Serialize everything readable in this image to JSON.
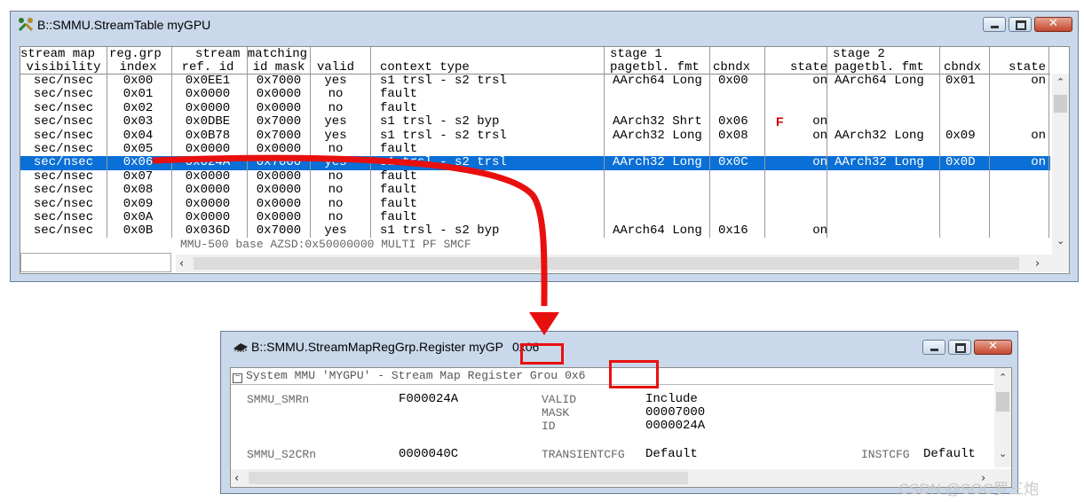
{
  "window1": {
    "title": "B::SMMU.StreamTable myGPU",
    "header_line1": [
      "stream map",
      "reg.grp",
      "stream matching",
      "stage 1",
      "stage 2"
    ],
    "header_line2": [
      "visibility",
      "index",
      "ref. id",
      "id mask",
      "valid",
      "context type",
      "pagetbl. fmt",
      "cbndx",
      "state",
      "pagetbl. fmt",
      "cbndx",
      "state"
    ],
    "rows": [
      [
        "sec/nsec",
        "0x00",
        "0x0EE1",
        "0x7000",
        "yes",
        "s1 trsl - s2 trsl",
        "AArch64 Long",
        "0x00",
        "",
        "on",
        "AArch64 Long",
        "0x01",
        "on"
      ],
      [
        "sec/nsec",
        "0x01",
        "0x0000",
        "0x0000",
        "no",
        "fault",
        "",
        "",
        "",
        "",
        "",
        "",
        ""
      ],
      [
        "sec/nsec",
        "0x02",
        "0x0000",
        "0x0000",
        "no",
        "fault",
        "",
        "",
        "",
        "",
        "",
        "",
        ""
      ],
      [
        "sec/nsec",
        "0x03",
        "0x0DBE",
        "0x7000",
        "yes",
        "s1 trsl - s2 byp",
        "AArch32 Shrt",
        "0x06",
        "F",
        "on",
        "",
        "",
        ""
      ],
      [
        "sec/nsec",
        "0x04",
        "0x0B78",
        "0x7000",
        "yes",
        "s1 trsl - s2 trsl",
        "AArch32 Long",
        "0x08",
        "",
        "on",
        "AArch32 Long",
        "0x09",
        "on"
      ],
      [
        "sec/nsec",
        "0x05",
        "0x0000",
        "0x0000",
        "no",
        "fault",
        "",
        "",
        "",
        "",
        "",
        "",
        ""
      ],
      [
        "sec/nsec",
        "0x06",
        "0x024A",
        "0x7000",
        "yes",
        "s1 trsl - s2 trsl",
        "AArch32 Long",
        "0x0C",
        "",
        "on",
        "AArch32 Long",
        "0x0D",
        "on"
      ],
      [
        "sec/nsec",
        "0x07",
        "0x0000",
        "0x0000",
        "no",
        "fault",
        "",
        "",
        "",
        "",
        "",
        "",
        ""
      ],
      [
        "sec/nsec",
        "0x08",
        "0x0000",
        "0x0000",
        "no",
        "fault",
        "",
        "",
        "",
        "",
        "",
        "",
        ""
      ],
      [
        "sec/nsec",
        "0x09",
        "0x0000",
        "0x0000",
        "no",
        "fault",
        "",
        "",
        "",
        "",
        "",
        "",
        ""
      ],
      [
        "sec/nsec",
        "0x0A",
        "0x0000",
        "0x0000",
        "no",
        "fault",
        "",
        "",
        "",
        "",
        "",
        "",
        ""
      ],
      [
        "sec/nsec",
        "0x0B",
        "0x036D",
        "0x7000",
        "yes",
        "s1 trsl - s2 byp",
        "AArch64 Long",
        "0x16",
        "",
        "on",
        "",
        "",
        ""
      ]
    ],
    "selected_row": 6,
    "status_line": "MMU-500  base AZSD:0x50000000    MULTI       PF                SMCF"
  },
  "window2": {
    "title": "B::SMMU.StreamMapRegGrp.Register myGP",
    "title_highlight": "0x06",
    "tree_label": "System MMU 'MYGPU' - Stream Map Register Grou",
    "tree_highlight": "0x6",
    "registers": [
      {
        "name": "SMMU_SMRn",
        "value": "F000024A",
        "fields": [
          [
            "VALID",
            "Include"
          ],
          [
            "MASK",
            "00007000"
          ],
          [
            "ID",
            "0000024A"
          ]
        ]
      },
      {
        "name": "SMMU_S2CRn",
        "value": "0000040C",
        "fields": [
          [
            "TRANSIENTCFG",
            "Default"
          ]
        ],
        "extra_field": [
          "INSTCFG",
          "Default"
        ]
      }
    ]
  },
  "colors": {
    "selection": "#0a6fd6",
    "highlight_box": "#e8100f",
    "arrow": "#e8100f",
    "window_frame": "#c9d8ea",
    "fault_flag": "#cc0000"
  },
  "watermark": "CSDN @SOC罗三炮",
  "icons": {
    "window1": "wrench-icon",
    "window2": "chip-icon"
  }
}
